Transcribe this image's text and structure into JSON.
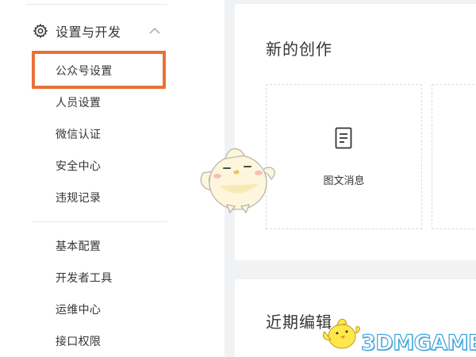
{
  "sidebar": {
    "section_title": "设置与开发",
    "section_icon": "gear-icon",
    "section_toggle_icon": "chevron-up-icon",
    "items": [
      {
        "label": "公众号设置",
        "highlighted": true
      },
      {
        "label": "人员设置"
      },
      {
        "label": "微信认证"
      },
      {
        "label": "安全中心"
      },
      {
        "label": "违规记录"
      }
    ],
    "dev_items": [
      {
        "label": "基本配置"
      },
      {
        "label": "开发者工具"
      },
      {
        "label": "运维中心"
      },
      {
        "label": "接口权限"
      }
    ],
    "highlight_color": "#e8713a"
  },
  "main": {
    "new_creation": {
      "title": "新的创作",
      "tiles": [
        {
          "label": "图文消息",
          "icon": "document-icon"
        }
      ]
    },
    "recent_edits": {
      "title": "近期编辑"
    }
  },
  "watermark": {
    "text": "3DMGAME",
    "color": "#3ea6dc"
  }
}
